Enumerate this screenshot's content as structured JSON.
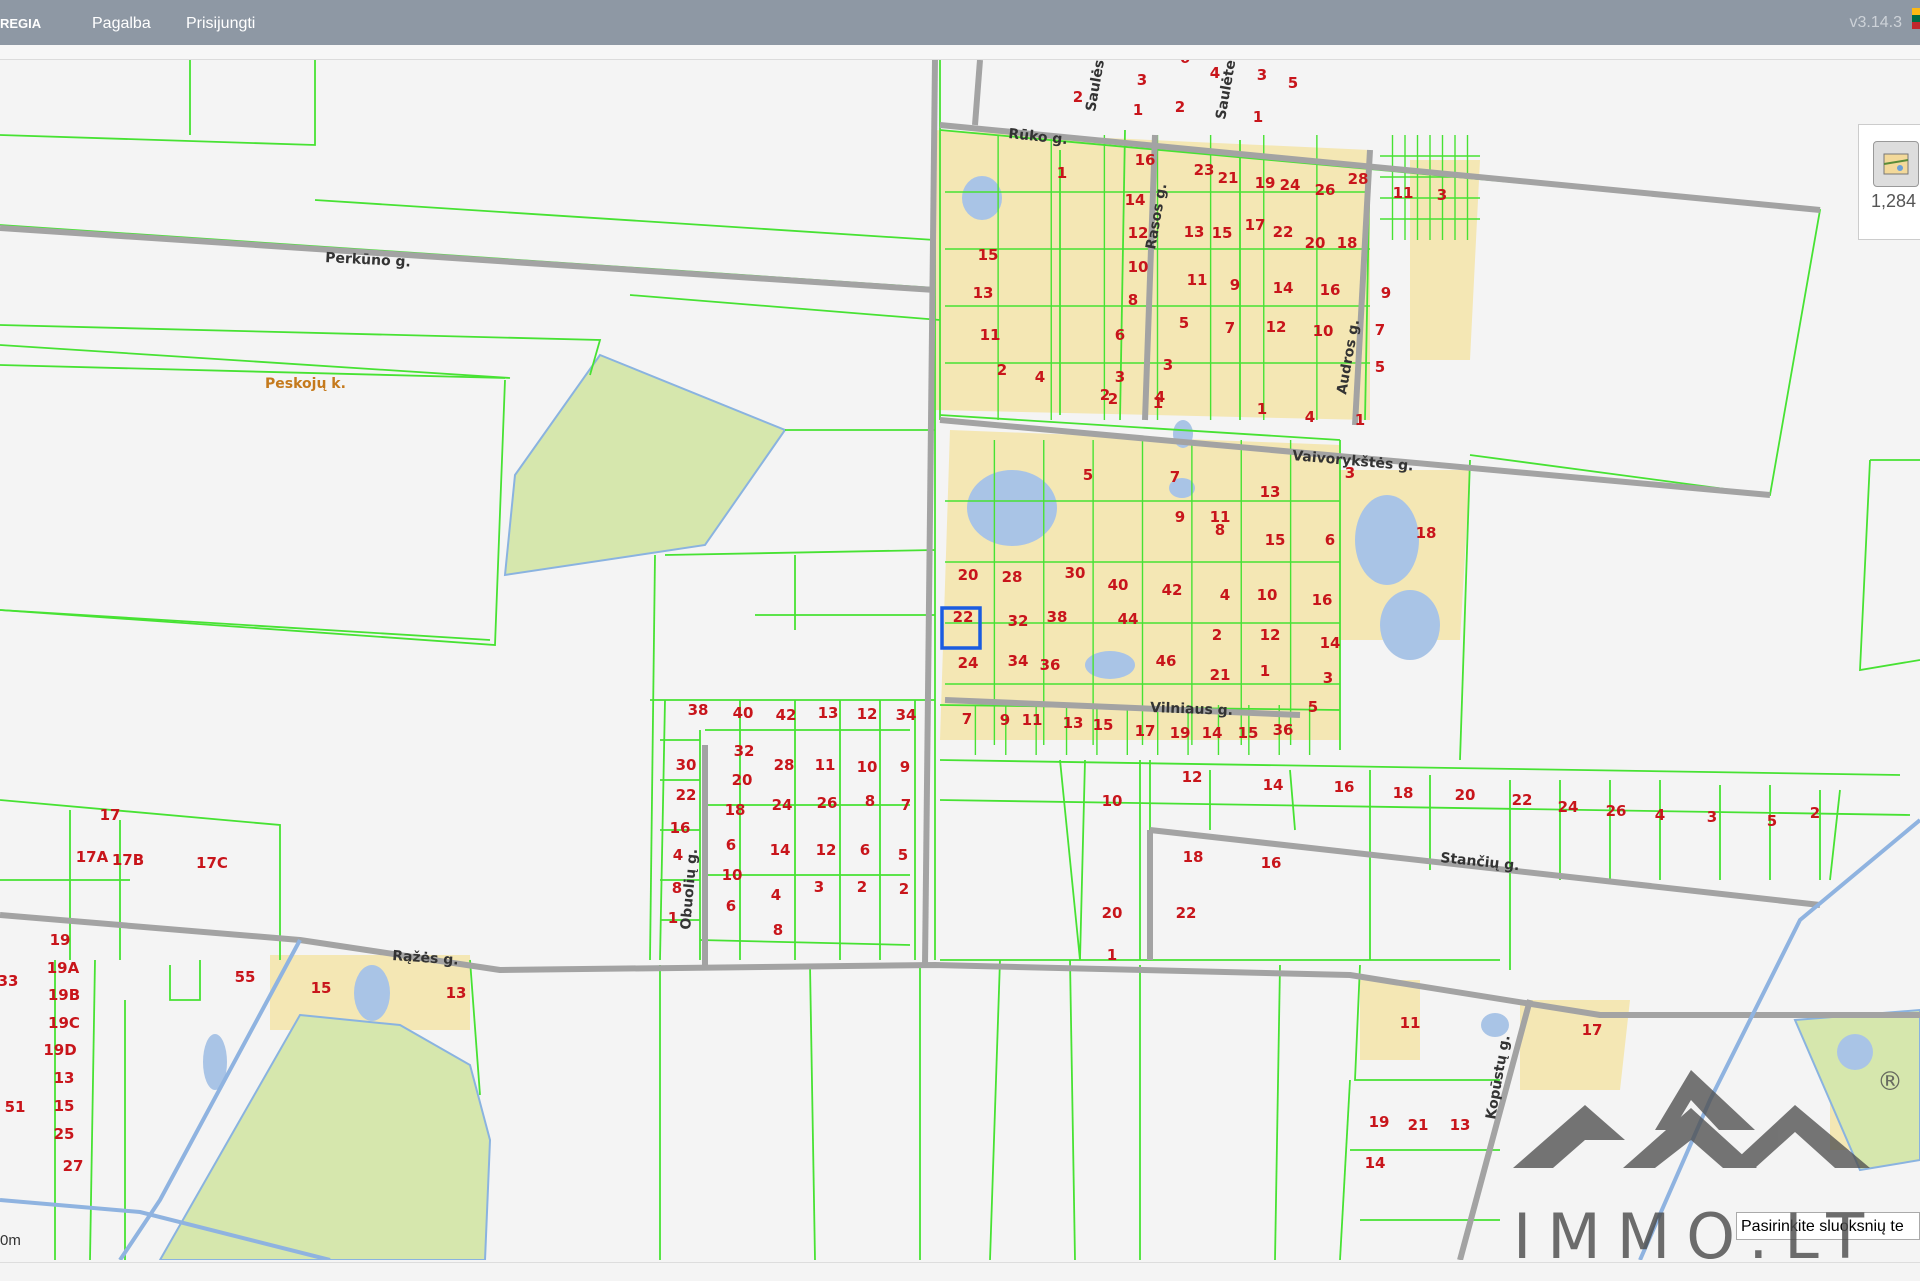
{
  "header": {
    "brand": "REGIA",
    "menu": [
      "Pagalba",
      "Prisijungti"
    ],
    "version": "v3.14.3"
  },
  "map": {
    "colors": {
      "parcel": "#47e233",
      "road": "#a3a3a3",
      "built": "#f4e7b4",
      "forest": "#d6e7ad",
      "water": "#a9c4e6",
      "number": "#c8151b",
      "street": "#333333",
      "place": "#c57a1d",
      "background": "#f4f4f4"
    },
    "streets": [
      "Perkūno g.",
      "Rūko g.",
      "Saulės",
      "Saulėtekio",
      "Rasos g.",
      "Audros g.",
      "Vaivorykštės g.",
      "Vilniaus g.",
      "Obuolių g.",
      "Stančių g.",
      "Rąžės g.",
      "Kopūstų g."
    ],
    "place": "Peskojų k.",
    "numbers": [
      "3",
      "6",
      "4",
      "3",
      "5",
      "2",
      "1",
      "2",
      "1",
      "16",
      "23",
      "21",
      "19",
      "24",
      "26",
      "28",
      "11",
      "3",
      "1",
      "14",
      "12",
      "13",
      "15",
      "17",
      "22",
      "20",
      "18",
      "15",
      "10",
      "11",
      "9",
      "14",
      "16",
      "9",
      "13",
      "8",
      "5",
      "7",
      "12",
      "10",
      "7",
      "11",
      "6",
      "3",
      "5",
      "2",
      "4",
      "3",
      "2",
      "4",
      "1",
      "4",
      "2",
      "1",
      "1",
      "3",
      "5",
      "7",
      "13",
      "9",
      "11",
      "15",
      "6",
      "8",
      "18",
      "20",
      "28",
      "30",
      "40",
      "42",
      "4",
      "10",
      "16",
      "22",
      "32",
      "38",
      "44",
      "2",
      "12",
      "14",
      "24",
      "34",
      "36",
      "46",
      "21",
      "1",
      "3",
      "5",
      "7",
      "9",
      "11",
      "13",
      "15",
      "17",
      "19",
      "14",
      "15",
      "36",
      "38",
      "40",
      "42",
      "13",
      "12",
      "34",
      "32",
      "30",
      "28",
      "11",
      "10",
      "9",
      "20",
      "22",
      "24",
      "26",
      "8",
      "7",
      "18",
      "16",
      "14",
      "12",
      "6",
      "5",
      "4",
      "6",
      "8",
      "10",
      "4",
      "3",
      "2",
      "2",
      "1",
      "6",
      "8",
      "10",
      "12",
      "14",
      "16",
      "18",
      "20",
      "22",
      "24",
      "26",
      "4",
      "3",
      "5",
      "2",
      "1",
      "18",
      "16",
      "20",
      "22",
      "17",
      "17A",
      "17B",
      "17C",
      "19",
      "19A",
      "19B",
      "19C",
      "19D",
      "13",
      "15",
      "25",
      "27",
      "33",
      "51",
      "55",
      "15",
      "13",
      "11",
      "17",
      "19",
      "21",
      "13",
      "14"
    ],
    "selected_parcel": "4",
    "scale_label": "0m"
  },
  "layers": {
    "scale_value": "1,284"
  },
  "layer_select": {
    "text": "Pasirinkite sluoksnių te"
  },
  "watermark": {
    "text": "IMMO.LT",
    "registered": "®"
  }
}
